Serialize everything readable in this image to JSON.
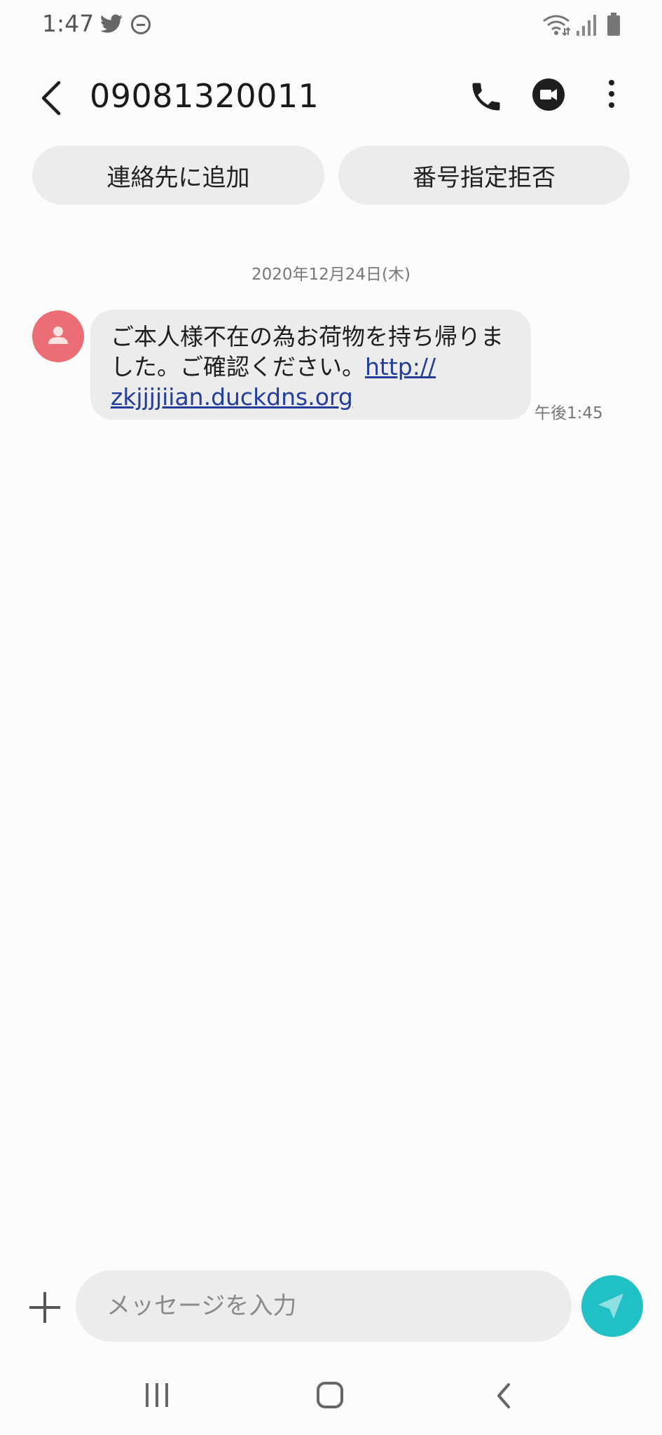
{
  "status_bar": {
    "time": "1:47",
    "icons": [
      "twitter-icon",
      "do-not-disturb-icon",
      "wifi-icon",
      "signal-icon",
      "battery-icon"
    ]
  },
  "header": {
    "title": "09081320011",
    "icons": [
      "back-arrow-icon",
      "phone-icon",
      "video-call-icon",
      "more-vert-icon"
    ]
  },
  "actions": {
    "add_contact": "連絡先に追加",
    "block_number": "番号指定拒否"
  },
  "conversation": {
    "date": "2020年12月24日(木)",
    "message": {
      "text": "ご本人様不在の為お荷物を持ち帰りました。ご確認ください。",
      "link_line1": "http://",
      "link_line2": "zkjjjjiian.duckdns.org",
      "time": "午後1:45",
      "avatar_icon": "person-icon"
    }
  },
  "composer": {
    "placeholder": "メッセージを入力",
    "value": ""
  },
  "colors": {
    "background": "#fcfcfc",
    "bubble": "#ececec",
    "link": "#233d9c",
    "avatar": "#ea6e73",
    "send_button": "#21c0c4"
  }
}
